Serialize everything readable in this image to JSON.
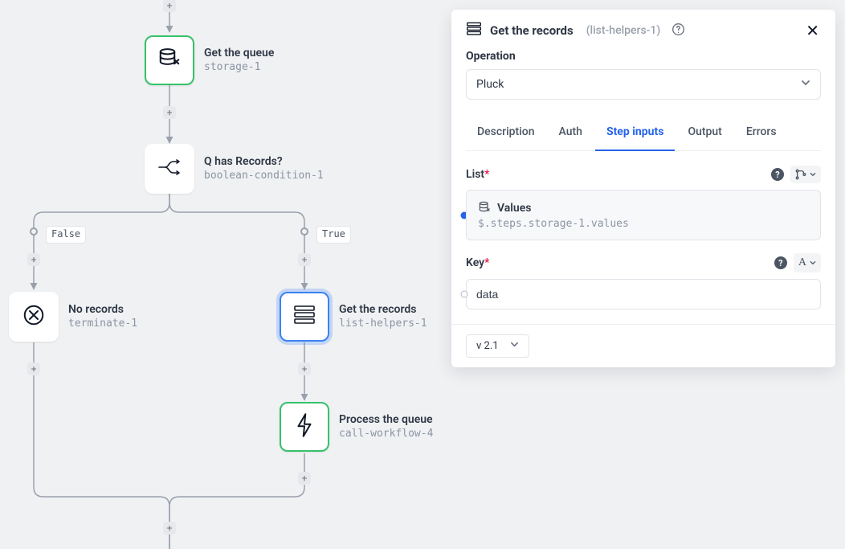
{
  "flow": {
    "nodes": {
      "queue": {
        "title": "Get the queue",
        "sub": "storage-1"
      },
      "cond": {
        "title": "Q has Records?",
        "sub": "boolean-condition-1"
      },
      "norec": {
        "title": "No records",
        "sub": "terminate-1"
      },
      "getrec": {
        "title": "Get the records",
        "sub": "list-helpers-1"
      },
      "process": {
        "title": "Process the queue",
        "sub": "call-workflow-4"
      }
    },
    "branch_labels": {
      "false": "False",
      "true": "True"
    }
  },
  "panel": {
    "title": "Get the records",
    "sub": "(list-helpers-1)",
    "operation_label": "Operation",
    "operation_value": "Pluck",
    "tabs": [
      "Description",
      "Auth",
      "Step inputs",
      "Output",
      "Errors"
    ],
    "active_tab": 2,
    "fields": {
      "list": {
        "label": "List",
        "item_title": "Values",
        "item_path": "$.steps.storage-1.values"
      },
      "key": {
        "label": "Key",
        "value": "data",
        "type_hint": "A"
      }
    },
    "version": "v 2.1"
  }
}
